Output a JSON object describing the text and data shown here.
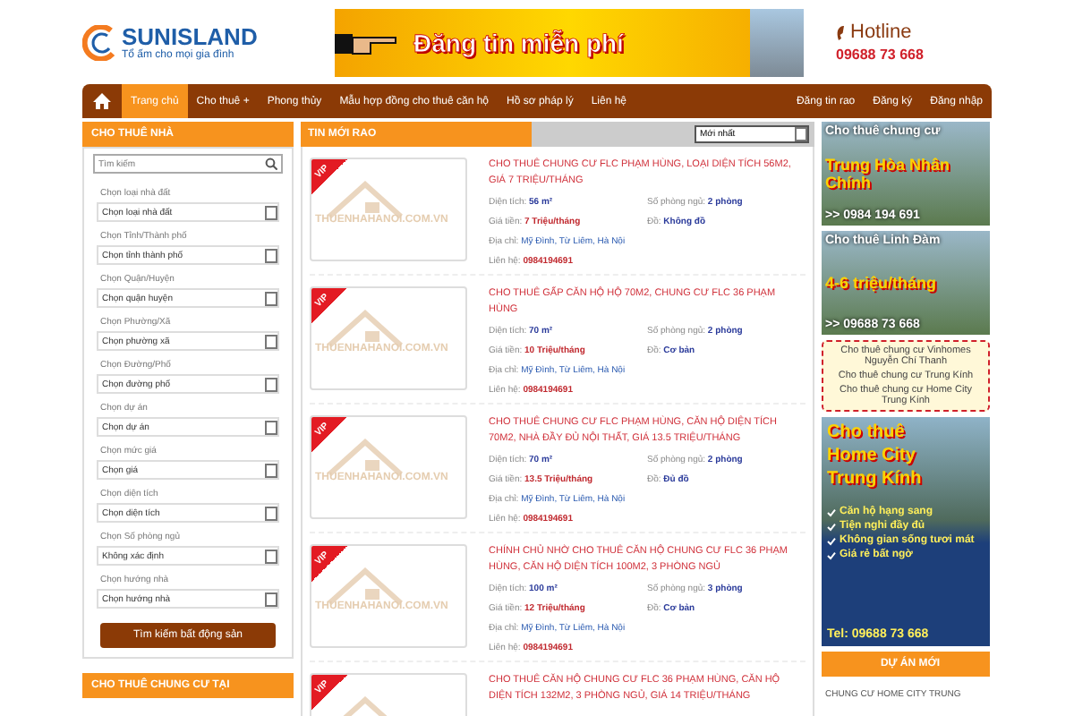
{
  "logo": {
    "name": "SUNISLAND",
    "tagline": "Tổ ấm cho mọi gia đình"
  },
  "top_banner": {
    "text": "Đăng tin miễn phí"
  },
  "hotline": {
    "label": "Hotline",
    "phone": "09688 73 668"
  },
  "nav": {
    "items": [
      {
        "label": "Trang chủ",
        "selected": true
      },
      {
        "label": "Cho thuê +",
        "selected": false
      },
      {
        "label": "Phong thủy",
        "selected": false
      },
      {
        "label": "Mẫu hợp đồng cho thuê căn hộ",
        "selected": false
      },
      {
        "label": "Hồ sơ pháp lý",
        "selected": false
      },
      {
        "label": "Liên hệ",
        "selected": false
      }
    ],
    "right_items": [
      "Đăng tin rao",
      "Đăng ký",
      "Đăng nhập"
    ]
  },
  "sidebar": {
    "title": "CHO THUÊ NHÀ",
    "search_placeholder": "Tìm kiếm",
    "filters": [
      {
        "label": "Chọn loại nhà đất",
        "value": "Chọn loại nhà đất"
      },
      {
        "label": "Chọn Tỉnh/Thành phố",
        "value": "Chọn tỉnh thành phố"
      },
      {
        "label": "Chọn Quận/Huyện",
        "value": "Chọn quận huyện"
      },
      {
        "label": "Chọn Phường/Xã",
        "value": "Chọn phường xã"
      },
      {
        "label": "Chọn Đường/Phố",
        "value": "Chọn đường phố"
      },
      {
        "label": "Chọn dự án",
        "value": "Chọn dự án"
      },
      {
        "label": "Chọn mức giá",
        "value": "Chọn giá"
      },
      {
        "label": "Chọn diện tích",
        "value": "Chọn diện tích"
      },
      {
        "label": "Chọn Số phòng ngủ",
        "value": "Không xác định"
      },
      {
        "label": "Chọn hướng nhà",
        "value": "Chọn hướng nhà"
      }
    ],
    "button": "Tìm kiếm bất động sản",
    "second_title": "CHO THUÊ CHUNG CƯ TẠI"
  },
  "listings_panel": {
    "title": "TIN MỚI RAO",
    "sort": "Mới nhất",
    "listings": [
      {
        "badge": "VIP",
        "watermark": "THUENHAHANOI.COM.VN",
        "title": "CHO THUÊ CHUNG CƯ FLC PHẠM HÙNG, LOẠI DIỆN TÍCH 56M2, GIÁ 7 TRIỆU/THÁNG",
        "fields": [
          {
            "kind": "bold",
            "label": "Diện tích:",
            "value": "56 m²"
          },
          {
            "kind": "bold",
            "label": "Số phòng ngủ:",
            "value": "2 phòng"
          },
          {
            "kind": "price",
            "label": "Giá tiền:",
            "value": "7 Triệu/tháng"
          },
          {
            "kind": "bold",
            "label": "Đồ:",
            "value": "Không đồ"
          },
          {
            "kind": "address",
            "label": "Địa chỉ:",
            "value": "Mỹ Đình, Từ Liêm, Hà Nội"
          },
          {
            "kind": "price",
            "label": "Liên hệ:",
            "value": "0984194691"
          }
        ]
      },
      {
        "badge": "VIP",
        "watermark": "THUENHAHANOI.COM.VN",
        "title": "CHO THUÊ GẤP CĂN HỘ HỘ 70M2, CHUNG CƯ FLC 36 PHẠM HÙNG",
        "fields": [
          {
            "kind": "bold",
            "label": "Diện tích:",
            "value": "70 m²"
          },
          {
            "kind": "bold",
            "label": "Số phòng ngủ:",
            "value": "2 phòng"
          },
          {
            "kind": "price",
            "label": "Giá tiền:",
            "value": "10 Triệu/tháng"
          },
          {
            "kind": "bold",
            "label": "Đồ:",
            "value": "Cơ bản"
          },
          {
            "kind": "address",
            "label": "Địa chỉ:",
            "value": "Mỹ Đình, Từ Liêm, Hà Nội"
          },
          {
            "kind": "price",
            "label": "Liên hệ:",
            "value": "0984194691"
          }
        ]
      },
      {
        "badge": "VIP",
        "watermark": "THUENHAHANOI.COM.VN",
        "title": "CHO THUÊ CHUNG CƯ FLC PHẠM HÙNG, CĂN HỘ DIỆN TÍCH 70M2, NHÀ ĐẦY ĐỦ NỘI THẤT, GIÁ 13.5 TRIỆU/THÁNG",
        "fields": [
          {
            "kind": "bold",
            "label": "Diện tích:",
            "value": "70 m²"
          },
          {
            "kind": "bold",
            "label": "Số phòng ngủ:",
            "value": "2 phòng"
          },
          {
            "kind": "price",
            "label": "Giá tiền:",
            "value": "13.5 Triệu/tháng"
          },
          {
            "kind": "bold",
            "label": "Đồ:",
            "value": "Đủ đồ"
          },
          {
            "kind": "address",
            "label": "Địa chỉ:",
            "value": "Mỹ Đình, Từ Liêm, Hà Nội"
          },
          {
            "kind": "price",
            "label": "Liên hệ:",
            "value": "0984194691"
          }
        ]
      },
      {
        "badge": "VIP",
        "watermark": "THUENHAHANOI.COM.VN",
        "title": "CHÍNH CHỦ NHỜ CHO THUÊ CĂN HỘ CHUNG CƯ FLC 36 PHẠM HÙNG, CĂN HỘ DIỆN TÍCH 100M2, 3 PHÒNG NGỦ",
        "fields": [
          {
            "kind": "bold",
            "label": "Diện tích:",
            "value": "100 m²"
          },
          {
            "kind": "bold",
            "label": "Số phòng ngủ:",
            "value": "3 phòng"
          },
          {
            "kind": "price",
            "label": "Giá tiền:",
            "value": "12 Triệu/tháng"
          },
          {
            "kind": "bold",
            "label": "Đồ:",
            "value": "Cơ bản"
          },
          {
            "kind": "address",
            "label": "Địa chỉ:",
            "value": "Mỹ Đình, Từ Liêm, Hà Nội"
          },
          {
            "kind": "price",
            "label": "Liên hệ:",
            "value": "0984194691"
          }
        ]
      },
      {
        "badge": "VIP",
        "title": "CHO THUÊ CĂN HỘ CHUNG CƯ FLC 36 PHẠM HÙNG, CĂN HỘ DIỆN TÍCH 132M2, 3 PHÒNG NGỦ, GIÁ 14 TRIỆU/THÁNG"
      }
    ]
  },
  "ads": [
    {
      "kind": "banner",
      "lines": [
        "Cho thuê chung cư",
        "Trung Hòa Nhân Chính",
        ">> 0984 194 691"
      ]
    },
    {
      "kind": "banner",
      "lines": [
        "Cho thuê Linh Đàm",
        "4-6 triệu/tháng",
        ">> 09688 73 668"
      ]
    },
    {
      "kind": "links",
      "links": [
        "Cho thuê chung cư Vinhomes Nguyễn Chí Thanh",
        "Cho thuê chung cư Trung Kính",
        "Cho thuê chung cư Home City Trung Kính"
      ]
    },
    {
      "kind": "promo",
      "lines": [
        "Cho thuê",
        "Home City",
        "Trung Kính"
      ],
      "bullets": [
        "Căn hộ hạng sang",
        "Tiện nghi đầy đủ",
        "Không gian sống tươi mát",
        "Giá rẻ bất ngờ"
      ],
      "tel": "Tel: 09688 73 668"
    }
  ],
  "projects": {
    "title": "DỰ ÁN MỚI",
    "first": "CHUNG CƯ HOME CITY TRUNG"
  }
}
